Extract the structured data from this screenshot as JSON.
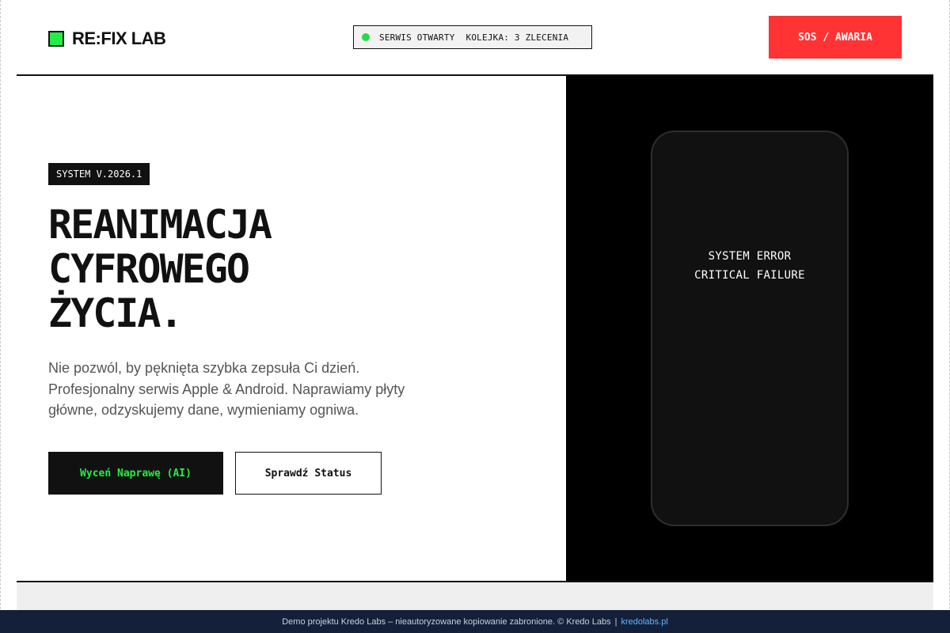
{
  "header": {
    "brand": "RE:FIX LAB",
    "status_open": "SERWIS OTWARTY",
    "status_queue": "KOLEJKA: 3 ZLECENIA",
    "sos_label": "SOS / AWARIA"
  },
  "hero": {
    "badge": "SYSTEM V.2026.1",
    "title_lines": [
      "REANIMACJA",
      "CYFROWEGO",
      "ŻYCIA."
    ],
    "description": "Nie pozwól, by pęknięta szybka zepsuła Ci dzień. Profesjonalny serwis Apple & Android. Naprawiamy płyty główne, odzyskujemy dane, wymieniamy ogniwa.",
    "primary_cta": "Wyceń Naprawę (AI)",
    "secondary_cta": "Sprawdź Status"
  },
  "phone": {
    "line1": "SYSTEM ERROR",
    "line2": "CRITICAL FAILURE"
  },
  "footer": {
    "notice": "Demo projektu Kredo Labs – nieautoryzowane kopiowanie zabronione. © Kredo Labs",
    "separator": "|",
    "link": "kredolabs.pl"
  },
  "colors": {
    "accent_green": "#22ee44",
    "sos_red": "#ff3333",
    "footer_bg": "#14203a",
    "link_blue": "#5cb8ff"
  },
  "icons": {
    "logo": "green-square-icon",
    "status": "status-dot-icon"
  }
}
